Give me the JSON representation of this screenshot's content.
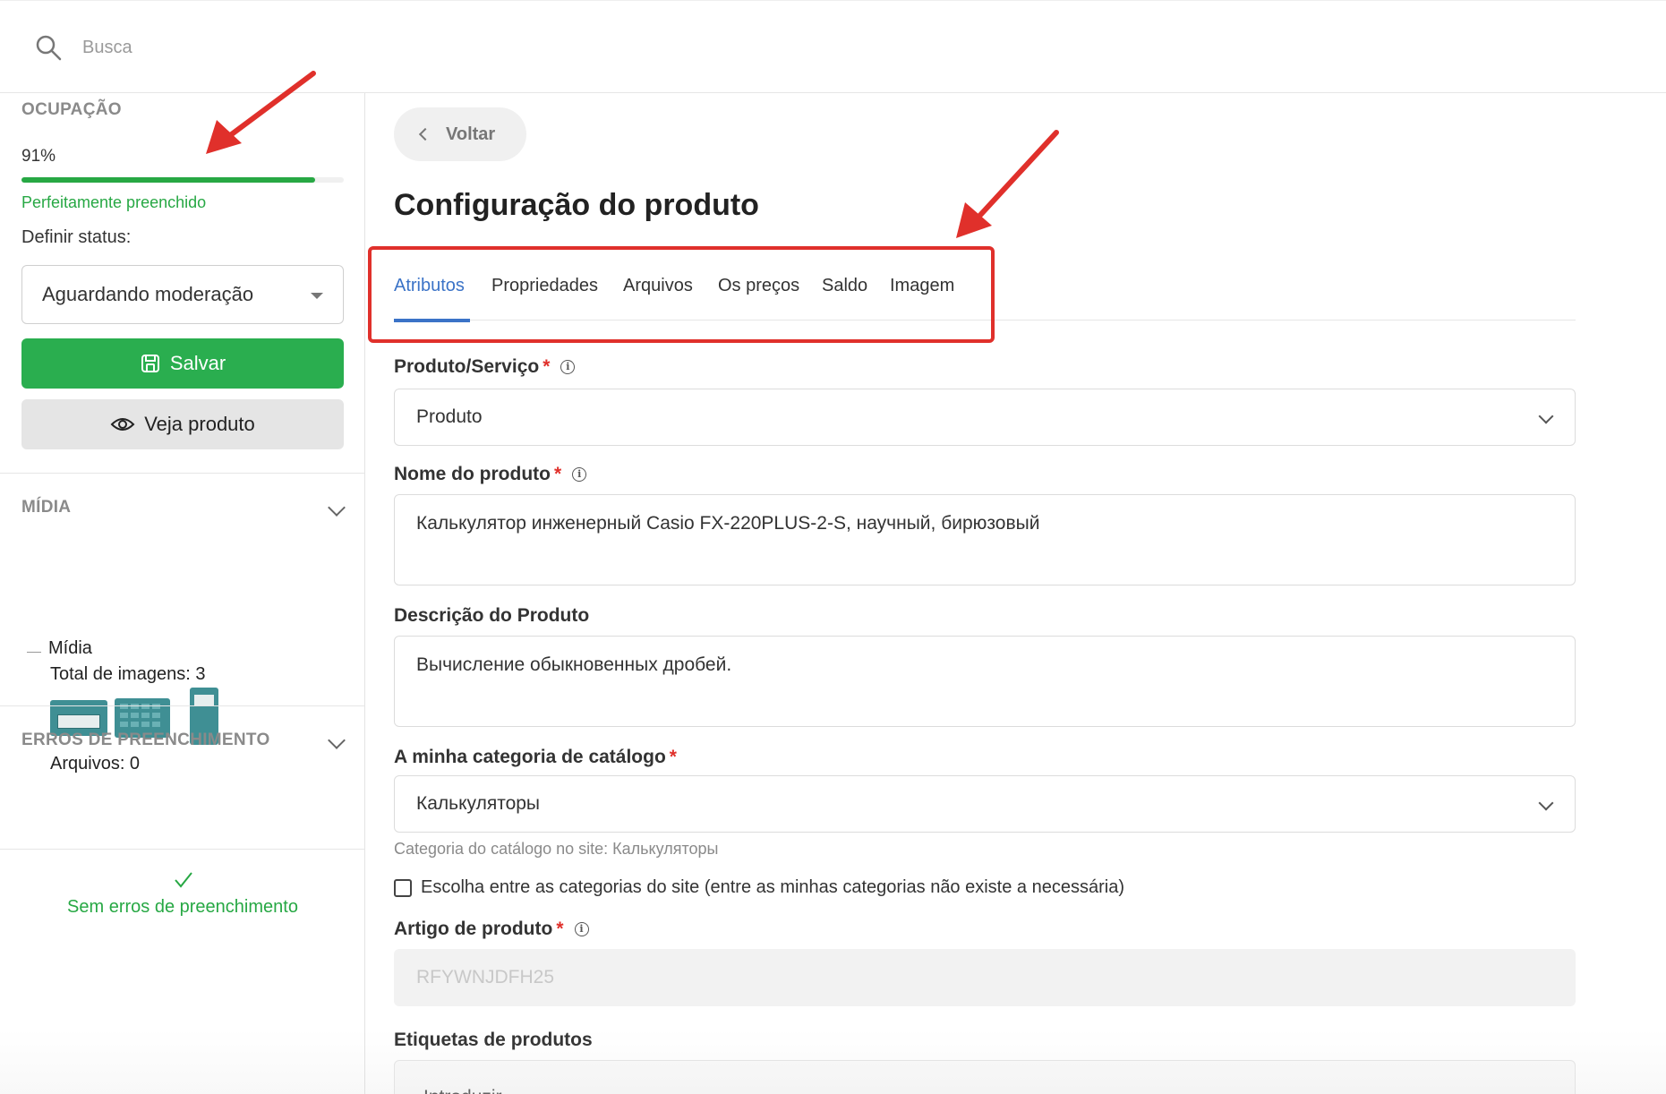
{
  "search": {
    "placeholder": "Busca"
  },
  "sidebar": {
    "occupancy": {
      "title": "OCUPAÇÃO",
      "percent_label": "91%",
      "percent": 0.91,
      "status": "Perfeitamente preenchido"
    },
    "status_label": "Definir status:",
    "status_value": "Aguardando moderação",
    "save_label": "Salvar",
    "view_label": "Veja produto",
    "media": {
      "title": "MÍDIA",
      "node_label": "Mídia",
      "total_images": "Total de imagens: 3",
      "files": "Arquivos: 0"
    },
    "errors": {
      "title": "ERROS DE PREENCHIMENTO",
      "message": "Sem erros de preenchimento"
    }
  },
  "main": {
    "back_label": "Voltar",
    "title": "Configuração do produto",
    "tabs": [
      {
        "label": "Atributos",
        "active": true
      },
      {
        "label": "Propriedades",
        "active": false
      },
      {
        "label": "Arquivos",
        "active": false
      },
      {
        "label": "Os preços",
        "active": false
      },
      {
        "label": "Saldo",
        "active": false
      },
      {
        "label": "Imagem",
        "active": false
      }
    ],
    "fields": {
      "product_service": {
        "label": "Produto/Serviço",
        "required_mark": "*",
        "value": "Produto"
      },
      "product_name": {
        "label": "Nome do produto",
        "required_mark": "*",
        "value": "Калькулятор инженерный Casio FX-220PLUS-2-S, научный, бирюзовый"
      },
      "description": {
        "label": "Descrição do Produto",
        "value": "Вычисление обыкновенных дробей."
      },
      "category": {
        "label": "A minha categoria de catálogo",
        "required_mark": "*",
        "value": "Калькуляторы",
        "hint": "Categoria do catálogo no site: Калькуляторы"
      },
      "choose_site_category": {
        "label": "Escolha entre as categorias do site (entre as minhas categorias não existe a necessária)",
        "checked": false
      },
      "article": {
        "label": "Artigo de produto",
        "required_mark": "*",
        "value": "RFYWNJDFH25"
      },
      "tags": {
        "label": "Etiquetas de produtos",
        "placeholder": "Introduzir"
      }
    }
  },
  "colors": {
    "accent_green": "#2aae4f",
    "tab_active": "#3b73c7",
    "highlight_red": "#e0302b"
  },
  "icons": {
    "search": "search-icon",
    "save": "floppy-disk-icon",
    "view": "eye-icon",
    "back": "chevron-left-icon",
    "info": "info-icon",
    "check": "check-icon",
    "annotation": "red-arrow-icon"
  }
}
